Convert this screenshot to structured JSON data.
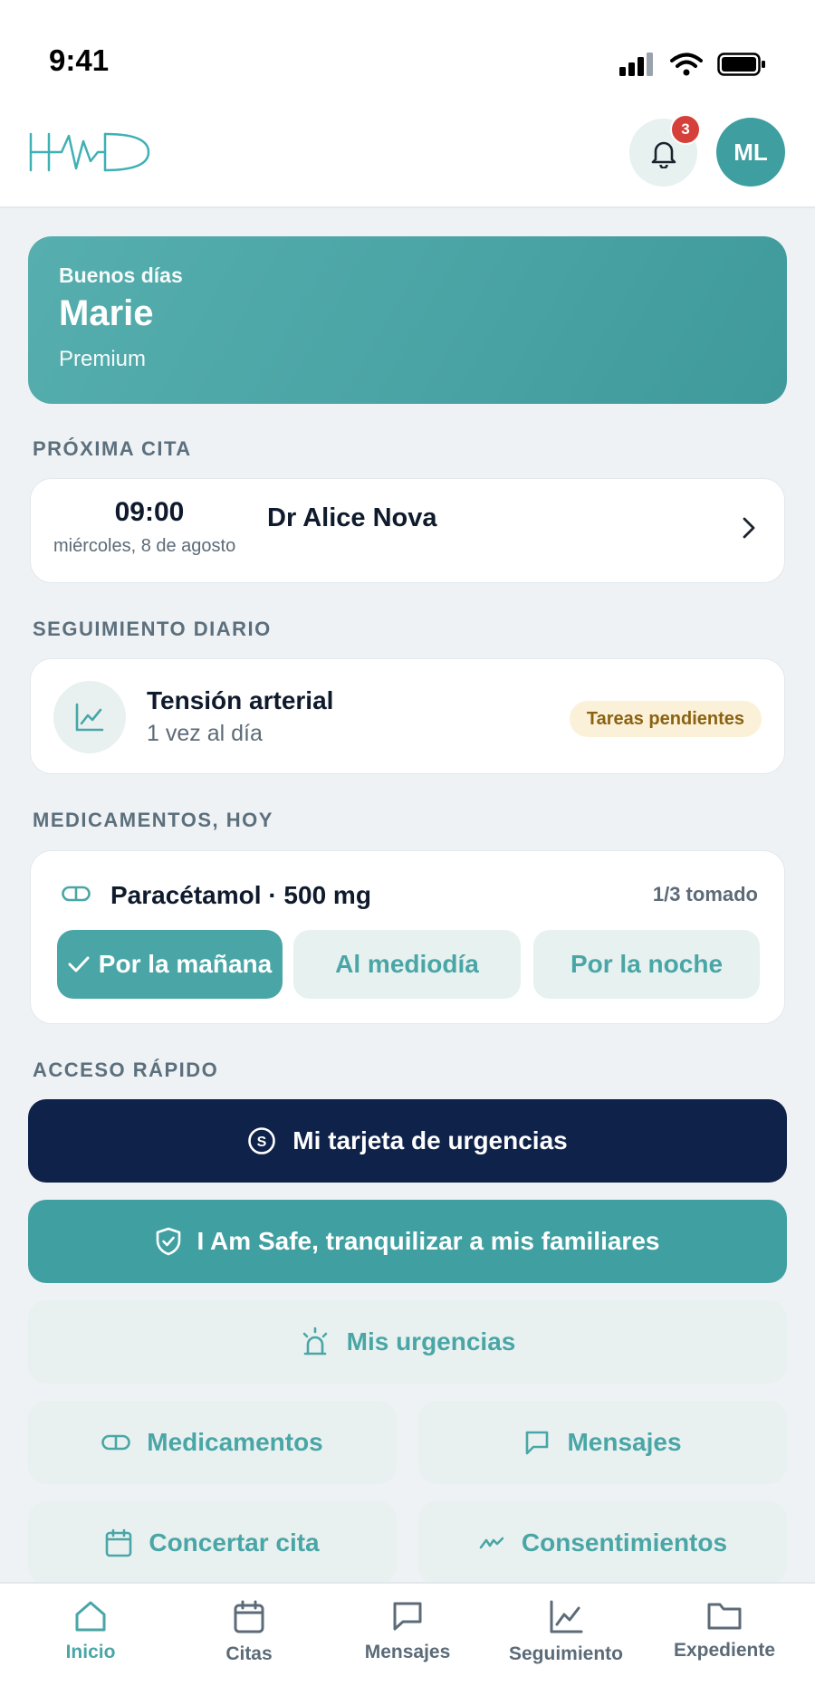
{
  "status_bar": {
    "time": "9:41"
  },
  "header": {
    "logo_icon": "hmd-logo",
    "notifications_count": "3",
    "avatar_initials": "ML"
  },
  "greeting": {
    "hello": "Buenos días",
    "name": "Marie",
    "plan": "Premium"
  },
  "sections": {
    "next_appointment": "PRÓXIMA CITA",
    "daily_tracking": "SEGUIMIENTO DIARIO",
    "meds_today": "MEDICAMENTOS, HOY",
    "quick_access": "ACCESO RÁPIDO"
  },
  "appointment": {
    "time": "09:00",
    "date": "miércoles, 8 de agosto",
    "doctor": "Dr Alice Nova"
  },
  "tracking": {
    "title": "Tensión arterial",
    "frequency": "1 vez al día",
    "badge": "Tareas pendientes"
  },
  "medication": {
    "name": "Paracétamol · 500 mg",
    "status": "1/3 tomado",
    "doses": [
      {
        "label": "Por la mañana",
        "taken": true
      },
      {
        "label": "Al mediodía",
        "taken": false
      },
      {
        "label": "Por la noche",
        "taken": false
      }
    ]
  },
  "quick_access": {
    "emergency_card": "Mi tarjeta de urgencias",
    "i_am_safe": "I Am Safe, tranquilizar a mis familiares",
    "my_emergencies": "Mis urgencias",
    "medications": "Medicamentos",
    "messages": "Mensajes",
    "book_appointment": "Concertar cita",
    "consents": "Consentimientos"
  },
  "bottom_nav": {
    "items": [
      {
        "label": "Inicio",
        "icon": "home-icon",
        "active": true
      },
      {
        "label": "Citas",
        "icon": "calendar-icon",
        "active": false
      },
      {
        "label": "Mensajes",
        "icon": "message-icon",
        "active": false
      },
      {
        "label": "Seguimiento",
        "icon": "chart-icon",
        "active": false
      },
      {
        "label": "Expediente",
        "icon": "folder-icon",
        "active": false
      }
    ]
  },
  "colors": {
    "accent": "#4aa6a6",
    "navy": "#0f224a",
    "badge_red": "#d6403a",
    "pending_bg": "#fbf1d8",
    "pending_text": "#8a6212"
  }
}
